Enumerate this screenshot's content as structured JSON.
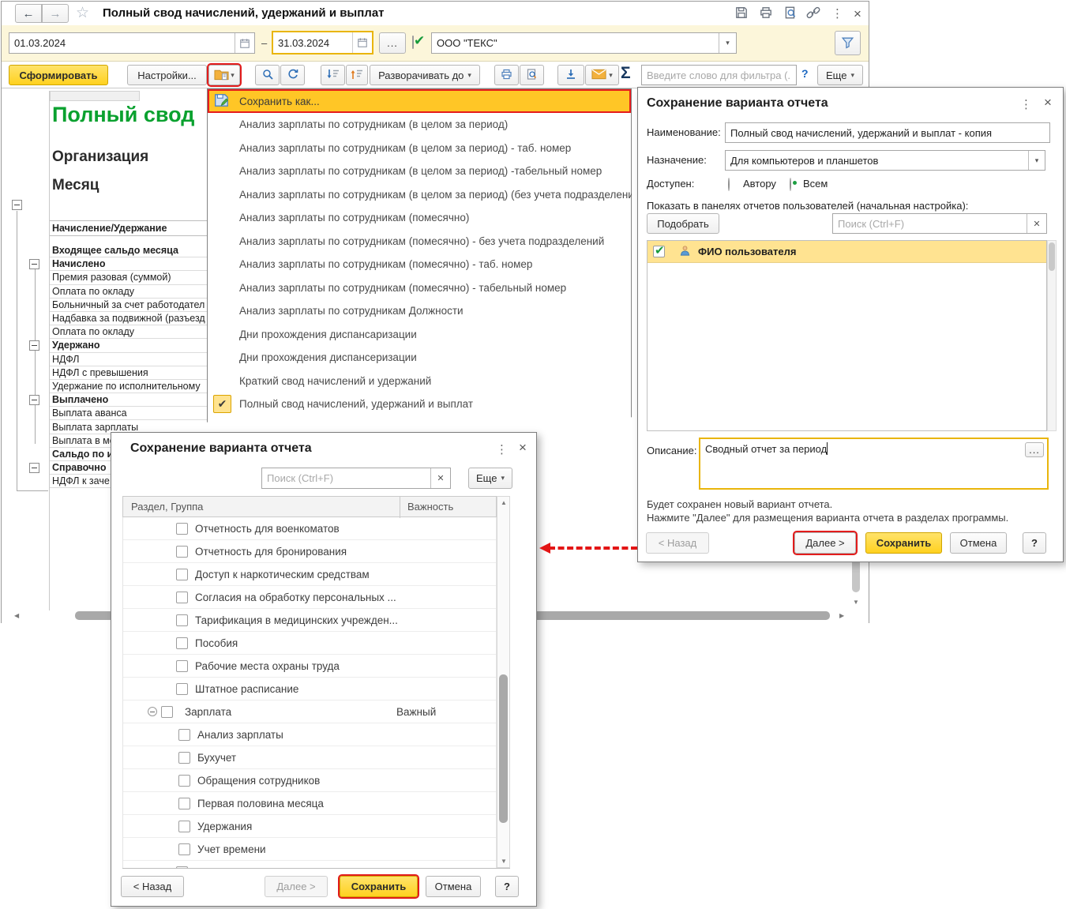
{
  "window": {
    "title": "Полный свод начислений, удержаний и выплат"
  },
  "filter": {
    "date_from": "01.03.2024",
    "range_dash": "–",
    "date_to": "31.03.2024",
    "ellipsis": "...",
    "organization": "ООО \"ТЕКС\""
  },
  "toolbar": {
    "generate": "Сформировать",
    "settings": "Настройки...",
    "expand_to": "Разворачивать до",
    "sigma": "Σ",
    "filter_placeholder": "Введите слово для фильтра (...",
    "help": "?",
    "more": "Еще"
  },
  "report": {
    "title": "Полный свод",
    "org_label": "Организация",
    "month_label": "Месяц",
    "column_header": "Начисление/Удержание",
    "rows": [
      {
        "label": "Входящее сальдо месяца",
        "group": true
      },
      {
        "label": "Начислено",
        "group": true,
        "expander": true
      },
      {
        "label": "Премия разовая (суммой)"
      },
      {
        "label": "Оплата по окладу"
      },
      {
        "label": "Больничный за счет работодател"
      },
      {
        "label": "Надбавка за подвижной (разъезд"
      },
      {
        "label": "Оплата по окладу"
      },
      {
        "label": "Удержано",
        "group": true,
        "expander": true
      },
      {
        "label": "НДФЛ"
      },
      {
        "label": "НДФЛ с превышения"
      },
      {
        "label": "Удержание по исполнительному"
      },
      {
        "label": "Выплачено",
        "group": true,
        "expander": true
      },
      {
        "label": "Выплата аванса"
      },
      {
        "label": "Выплата зарплаты"
      },
      {
        "label": "Выплата в ме"
      },
      {
        "label": "Сальдо по и",
        "group": true
      },
      {
        "label": "Справочно",
        "group": true,
        "expander": true
      },
      {
        "label": "НДФЛ к заче"
      }
    ]
  },
  "variants_menu": {
    "items": [
      {
        "label": "Сохранить как...",
        "save_as": true
      },
      {
        "label": "Анализ зарплаты по сотрудникам (в целом за период)"
      },
      {
        "label": "Анализ зарплаты по сотрудникам (в целом за период) - таб. номер"
      },
      {
        "label": "Анализ зарплаты по сотрудникам (в целом за период) -табельный номер"
      },
      {
        "label": "Анализ зарплаты по сотрудникам (в целом за период) (без учета подразделений)"
      },
      {
        "label": "Анализ зарплаты по сотрудникам (помесячно)"
      },
      {
        "label": "Анализ зарплаты по сотрудникам (помесячно) - без учета подразделений"
      },
      {
        "label": "Анализ зарплаты по сотрудникам (помесячно) - таб. номер"
      },
      {
        "label": "Анализ зарплаты по сотрудникам (помесячно) - табельный номер"
      },
      {
        "label": "Анализ зарплаты по сотрудникам Должности"
      },
      {
        "label": "Дни прохождения диспансаризации"
      },
      {
        "label": "Дни прохождения диспансеризации"
      },
      {
        "label": "Краткий свод начислений и удержаний"
      },
      {
        "label": "Полный свод начислений, удержаний и выплат",
        "checked": true
      }
    ]
  },
  "save_dialog": {
    "title": "Сохранение варианта отчета",
    "name_label": "Наименование:",
    "name_value": "Полный свод начислений, удержаний и выплат - копия",
    "purpose_label": "Назначение:",
    "purpose_value": "Для компьютеров и планшетов",
    "access_label": "Доступен:",
    "access_author": "Автору",
    "access_all": "Всем",
    "show_in_panels_label": "Показать в панелях отчетов пользователей (начальная настройка):",
    "pick_button": "Подобрать",
    "search_placeholder": "Поиск (Ctrl+F)",
    "user_name": "ФИО пользователя",
    "description_label": "Описание:",
    "description_value": "Сводный отчет за период",
    "ellipsis": "...",
    "info_line1": "Будет сохранен новый вариант отчета.",
    "info_line2": "Нажмите \"Далее\" для размещения варианта отчета в разделах программы.",
    "back": "< Назад",
    "next": "Далее >",
    "save": "Сохранить",
    "cancel": "Отмена",
    "help": "?"
  },
  "sections_dialog": {
    "title": "Сохранение варианта отчета",
    "search_placeholder": "Поиск (Ctrl+F)",
    "more": "Еще",
    "col_section": "Раздел, Группа",
    "col_importance": "Важность",
    "rows": [
      {
        "label": "Отчетность для военкоматов"
      },
      {
        "label": "Отчетность для бронирования"
      },
      {
        "label": "Доступ к наркотическим средствам"
      },
      {
        "label": "Согласия на обработку персональных ..."
      },
      {
        "label": "Тарификация в медицинских учрежден..."
      },
      {
        "label": "Пособия"
      },
      {
        "label": "Рабочие места охраны труда"
      },
      {
        "label": "Штатное расписание"
      },
      {
        "label": "Зарплата",
        "parent": true,
        "checked": true,
        "importance": "Важный"
      },
      {
        "label": "Анализ зарплаты",
        "child": true
      },
      {
        "label": "Бухучет",
        "child": true
      },
      {
        "label": "Обращения сотрудников",
        "child": true
      },
      {
        "label": "Первая половина месяца",
        "child": true
      },
      {
        "label": "Удержания",
        "child": true
      },
      {
        "label": "Учет времени",
        "child": true
      }
    ],
    "back": "< Назад",
    "next": "Далее >",
    "save": "Сохранить",
    "cancel": "Отмена",
    "help": "?"
  },
  "colors": {
    "accent_yellow": "#ffd21f",
    "highlight_red": "#e21b1b",
    "selection_yellow": "#ffe391",
    "menu_highlight": "#ffc626",
    "report_title_green": "#0aa12f"
  }
}
